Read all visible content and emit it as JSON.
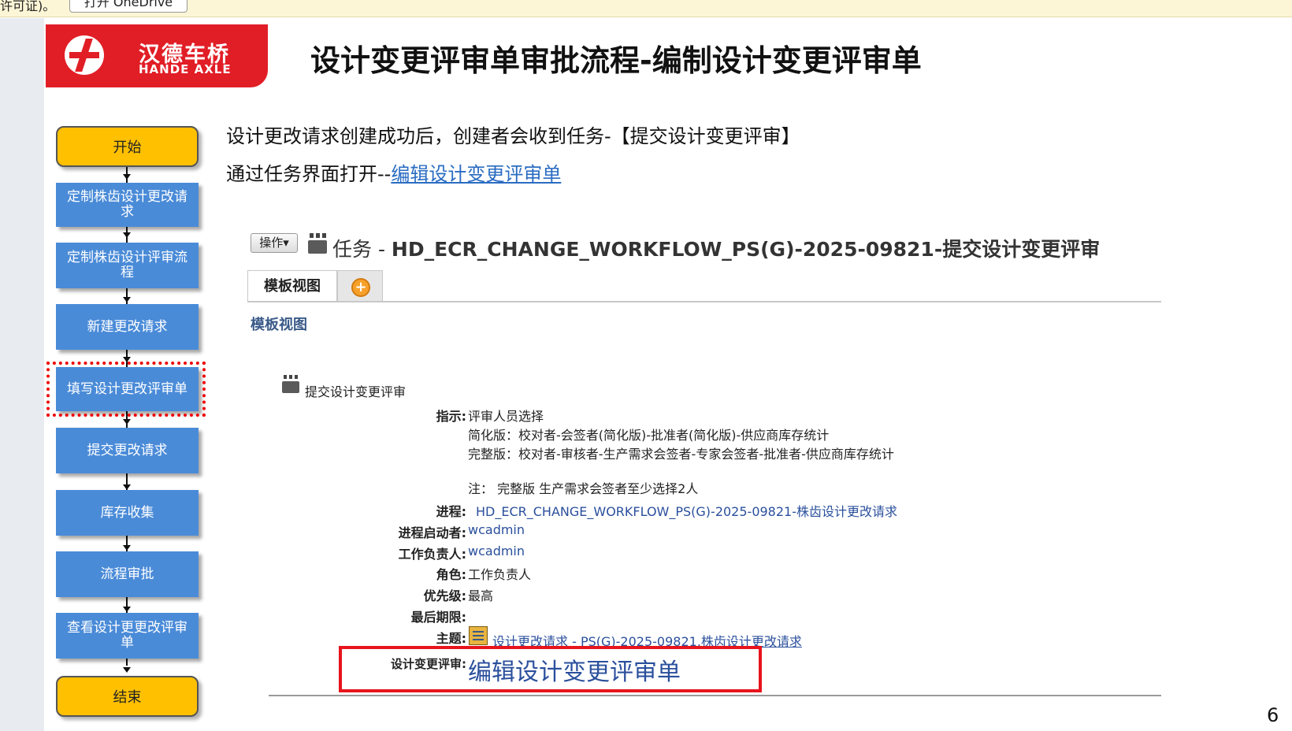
{
  "notification": {
    "text": "许可证)。",
    "button_label": "打开 OneDrive"
  },
  "header": {
    "logo_cn": "汉德车桥",
    "logo_en": "HANDE AXLE",
    "title": "设计变更评审单审批流程-编制设计变更评审单"
  },
  "flow": {
    "start": "开始",
    "steps": [
      "定制株齿设计更改请求",
      "定制株齿设计评审流程",
      "新建更改请求",
      "填写设计更改评审单",
      "提交更改请求",
      "库存收集",
      "流程审批",
      "查看设计更更改评审单"
    ],
    "end": "结束",
    "highlighted_step": "填写设计更改评审单"
  },
  "intro": {
    "line1": "设计更改请求创建成功后，创建者会收到任务-【提交设计变更评审】",
    "line2_prefix": "通过任务界面打开--",
    "line2_link": "编辑设计变更评审单"
  },
  "task": {
    "actions_label": "操作▾",
    "title_prefix": "任务 - ",
    "title_bold": "HD_ECR_CHANGE_WORKFLOW_PS(G)-2025-09821-提交设计变更评审",
    "tab_template": "模板视图",
    "section_label": "模板视图",
    "subtask_title": "提交设计变更评审",
    "fields": {
      "instruction_label": "指示:",
      "instruction_value": "评审人员选择",
      "simplified": "简化版：校对者-会签者(简化版)-批准者(简化版)-供应商库存统计",
      "complete": "完整版：校对者-审核者-生产需求会签者-专家会签者-批准者-供应商库存统计",
      "note": "注：  完整版 生产需求会签者至少选择2人",
      "process_label": "进程:",
      "process_value": "HD_ECR_CHANGE_WORKFLOW_PS(G)-2025-09821-株齿设计更改请求",
      "initiator_label": "进程启动者:",
      "initiator_value": "wcadmin",
      "owner_label": "工作负责人:",
      "owner_value": "wcadmin",
      "role_label": "角色:",
      "role_value": "工作负责人",
      "priority_label": "优先级:",
      "priority_value": "最高",
      "deadline_label": "最后期限:",
      "deadline_value": "",
      "subject_label": "主题:",
      "subject_value": "设计更改请求 - PS(G)-2025-09821,株齿设计更改请求",
      "review_label": "设计变更评审:",
      "review_link": "编辑设计变更评审单"
    }
  },
  "page_number": "6",
  "colors": {
    "brand_red": "#e11e26",
    "flow_blue": "#4a8bd8",
    "terminal_yellow": "#ffc000",
    "link_blue": "#2a4f9c",
    "highlight_red": "#e8141c"
  }
}
